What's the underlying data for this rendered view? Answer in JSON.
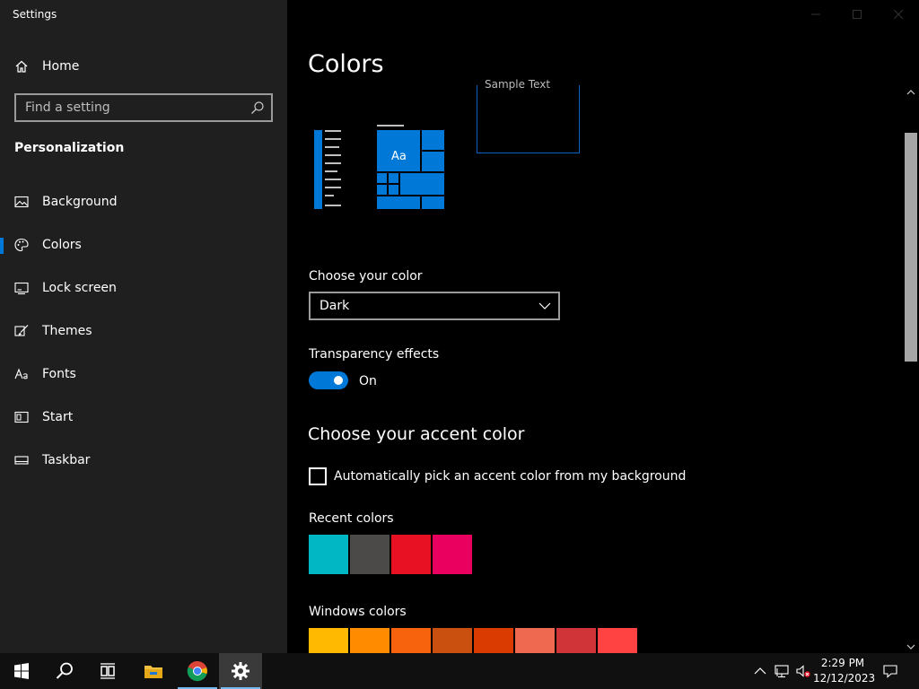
{
  "window": {
    "title": "Settings"
  },
  "sidebar": {
    "home_label": "Home",
    "search_placeholder": "Find a setting",
    "section_title": "Personalization",
    "items": [
      {
        "label": "Background",
        "icon": "picture-icon"
      },
      {
        "label": "Colors",
        "icon": "palette-icon",
        "selected": true
      },
      {
        "label": "Lock screen",
        "icon": "lock-screen-icon"
      },
      {
        "label": "Themes",
        "icon": "themes-brush-icon"
      },
      {
        "label": "Fonts",
        "icon": "fonts-icon"
      },
      {
        "label": "Start",
        "icon": "start-icon"
      },
      {
        "label": "Taskbar",
        "icon": "taskbar-icon"
      }
    ]
  },
  "main": {
    "title": "Colors",
    "preview": {
      "tile_text": "Aa",
      "sample_text": "Sample Text"
    },
    "choose_color": {
      "label": "Choose your color",
      "value": "Dark"
    },
    "transparency": {
      "label": "Transparency effects",
      "state": "On"
    },
    "accent": {
      "heading": "Choose your accent color",
      "auto_label": "Automatically pick an accent color from my background",
      "recent_label": "Recent colors",
      "recent_colors": [
        "#00b7c3",
        "#4c4a48",
        "#e81123",
        "#ea005e"
      ],
      "windows_label": "Windows colors",
      "windows_colors": [
        "#ffb900",
        "#ff8c00",
        "#f7630c",
        "#ca5010",
        "#da3b01",
        "#ef6950",
        "#d13438",
        "#ff4343"
      ]
    }
  },
  "accent_color": "#0078d7",
  "taskbar": {
    "time": "2:29 PM",
    "date": "12/12/2023",
    "icons": [
      "windows-start-icon",
      "search-icon",
      "task-view-icon",
      "file-explorer-icon",
      "chrome-icon",
      "settings-gear-icon"
    ],
    "tray": [
      "chevron-up-icon",
      "network-icon",
      "volume-muted-icon",
      "notifications-icon"
    ]
  }
}
